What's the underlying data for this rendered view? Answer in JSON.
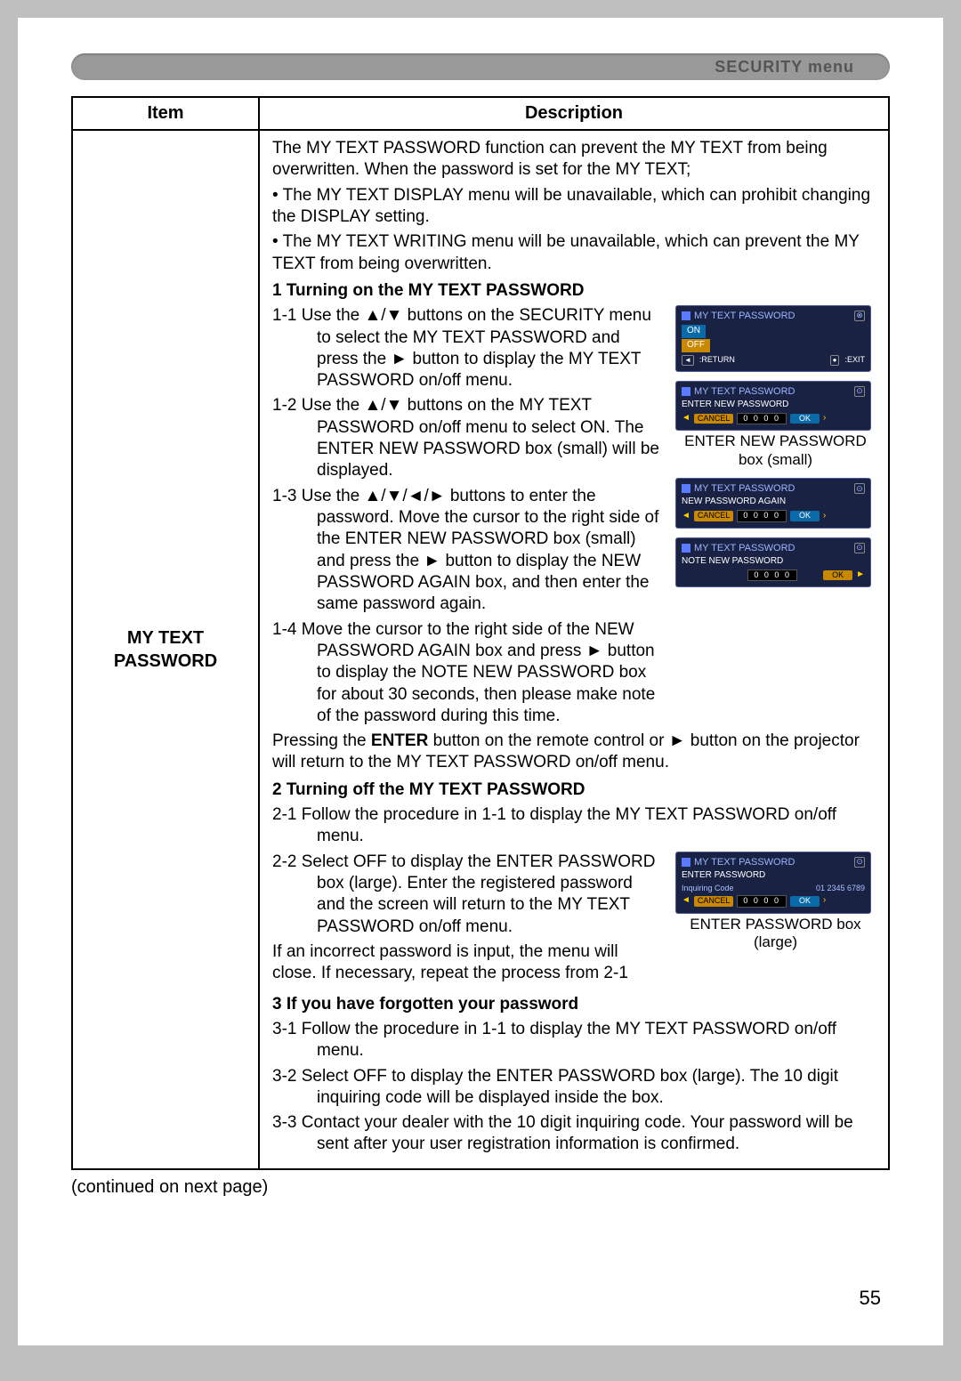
{
  "menu_title": "SECURITY menu",
  "headers": {
    "item": "Item",
    "description": "Description"
  },
  "item_name_1": "MY TEXT",
  "item_name_2": "PASSWORD",
  "intro": {
    "p1": "The MY TEXT PASSWORD function can prevent the MY TEXT from being overwritten. When the password is set for the MY TEXT;",
    "b1": "• The MY TEXT DISPLAY menu will be unavailable, which can prohibit changing the DISPLAY setting.",
    "b2": "• The MY TEXT WRITING menu will be unavailable, which can prevent the MY TEXT from being overwritten."
  },
  "sec1": {
    "head": "1 Turning on the MY TEXT PASSWORD",
    "s1": "1-1 Use the ▲/▼ buttons on the SECURITY menu to select the MY TEXT PASSWORD and press the ► button to display the MY TEXT PASSWORD on/off menu.",
    "s2": "1-2 Use the ▲/▼ buttons on the MY TEXT PASSWORD on/off menu to select ON. The ENTER NEW PASSWORD box (small) will be displayed.",
    "s3": "1-3 Use the ▲/▼/◄/► buttons to enter the password. Move the cursor to the right side of the ENTER NEW PASSWORD box (small) and press the ► button to display the NEW PASSWORD AGAIN box, and then enter the same password again.",
    "s4": "1-4 Move the cursor to the right side of the NEW PASSWORD AGAIN box and press ► button to display the NOTE NEW PASSWORD box for about 30 seconds, then please make note of the password during this time.",
    "foot": "Pressing the ENTER button on the remote control or ► button on the projector will return to the MY TEXT PASSWORD on/off menu."
  },
  "sec2": {
    "head": "2 Turning off the MY TEXT PASSWORD",
    "s1": "2-1 Follow the procedure in 1-1 to display the MY TEXT PASSWORD on/off menu.",
    "s2": "2-2 Select OFF to display the ENTER PASSWORD box (large). Enter the registered password and the screen will return to the MY TEXT PASSWORD on/off menu.",
    "foot": "If an incorrect password is input, the menu will close. If necessary, repeat the process from 2-1"
  },
  "sec3": {
    "head": "3 If you have forgotten your password",
    "s1": "3-1 Follow the procedure in 1-1 to display the MY TEXT PASSWORD on/off menu.",
    "s2": "3-2 Select OFF to display the ENTER PASSWORD box (large). The 10 digit inquiring code will be displayed inside the box.",
    "s3": "3-3 Contact your dealer with the 10 digit inquiring code. Your password will be sent after your user registration information is confirmed."
  },
  "dlg": {
    "title": "MY TEXT PASSWORD",
    "on": "ON",
    "off": "OFF",
    "return": ":RETURN",
    "exit": ":EXIT",
    "enter_new": "ENTER NEW PASSWORD",
    "cancel": "CANCEL",
    "ok": "OK",
    "digits": "0 0 0 0",
    "cap_enter_small_1": "ENTER NEW PASSWORD",
    "cap_enter_small_2": "box (small)",
    "new_again": "NEW PASSWORD AGAIN",
    "note_new": "NOTE NEW PASSWORD",
    "enter_pwd": "ENTER PASSWORD",
    "inq_label": "Inquiring Code",
    "inq_code": "01 2345 6789",
    "cap_enter_large_1": "ENTER PASSWORD box",
    "cap_enter_large_2": "(large)"
  },
  "continued": "(continued on next page)",
  "page_number": "55"
}
